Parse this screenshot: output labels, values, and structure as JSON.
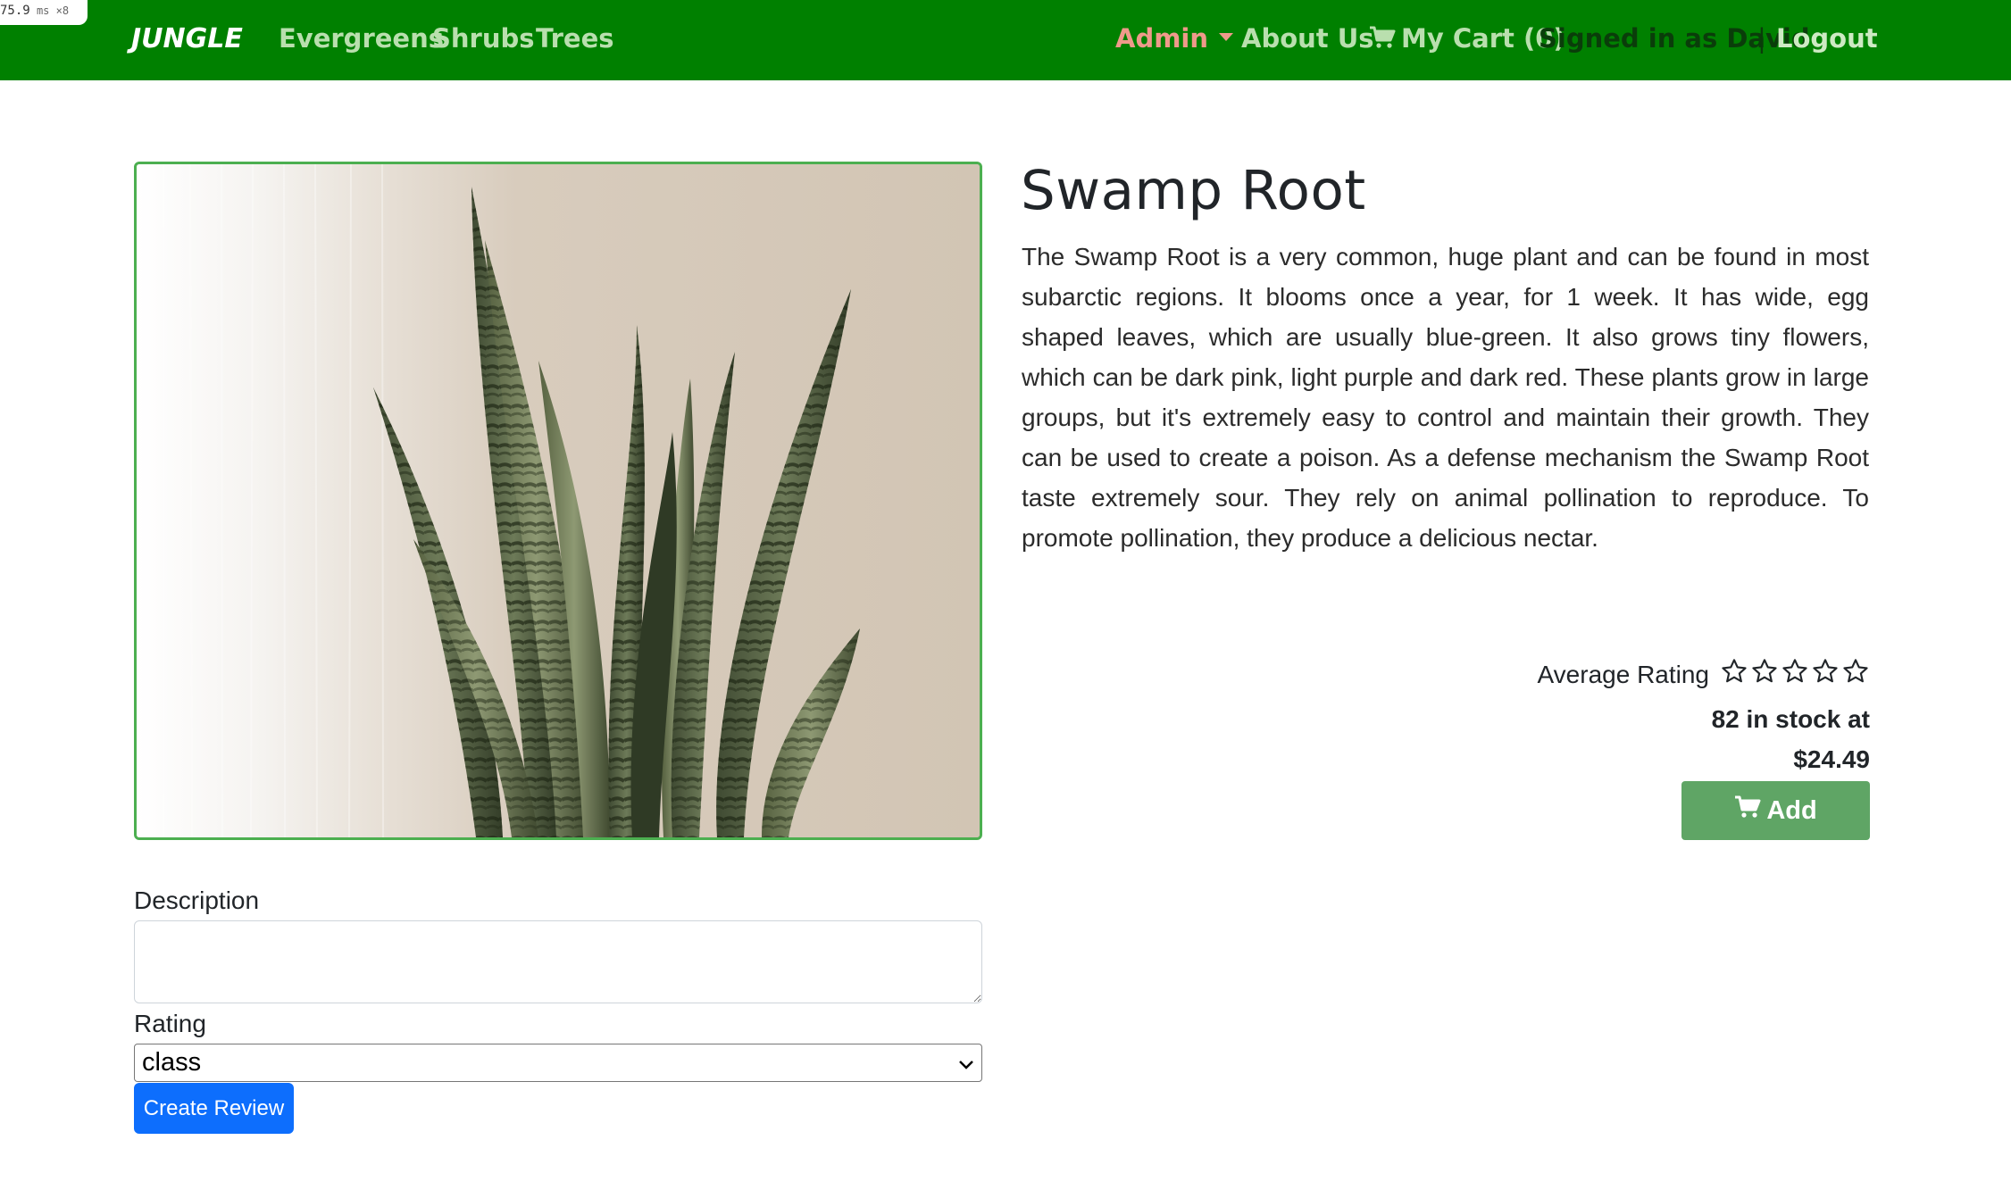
{
  "perf": {
    "value": "75.9",
    "unit": "ms",
    "multiplier": "×8"
  },
  "nav": {
    "brand": "JUNGLE",
    "links": [
      "Evergreens",
      "Shrubs",
      "Trees"
    ],
    "admin": "Admin",
    "about": "About Us",
    "cart": "My Cart (0)",
    "signed_in": "Signed in as David",
    "separator": "|",
    "logout": "Logout"
  },
  "product": {
    "title": "Swamp Root",
    "description": "The Swamp Root is a very common, huge plant and can be found in most subarctic regions. It blooms once a year, for 1 week. It has wide, egg shaped leaves, which are usually blue-green. It also grows tiny flowers, which can be dark pink, light purple and dark red. These plants grow in large groups, but it's extremely easy to control and maintain their growth. They can be used to create a poison. As a defense mechanism the Swamp Root taste extremely sour. They rely on animal pollination to reproduce. To promote pollination, they produce a delicious nectar.",
    "average_rating_label": "Average Rating",
    "average_rating_value": 0,
    "rating_max": 5,
    "stock": "82 in stock at",
    "price": "$24.49",
    "add_label": "Add",
    "image_icon": "snake-plant-photo"
  },
  "review_form": {
    "description_label": "Description",
    "description_value": "",
    "rating_label": "Rating",
    "rating_selected": "class",
    "submit_label": "Create Review"
  },
  "colors": {
    "navbar": "#008000",
    "nav_link": "#b9dfae",
    "admin": "#ef9a8a",
    "image_border": "#4caf50",
    "add_button": "#5fa565",
    "create_review": "#0d6efd"
  }
}
